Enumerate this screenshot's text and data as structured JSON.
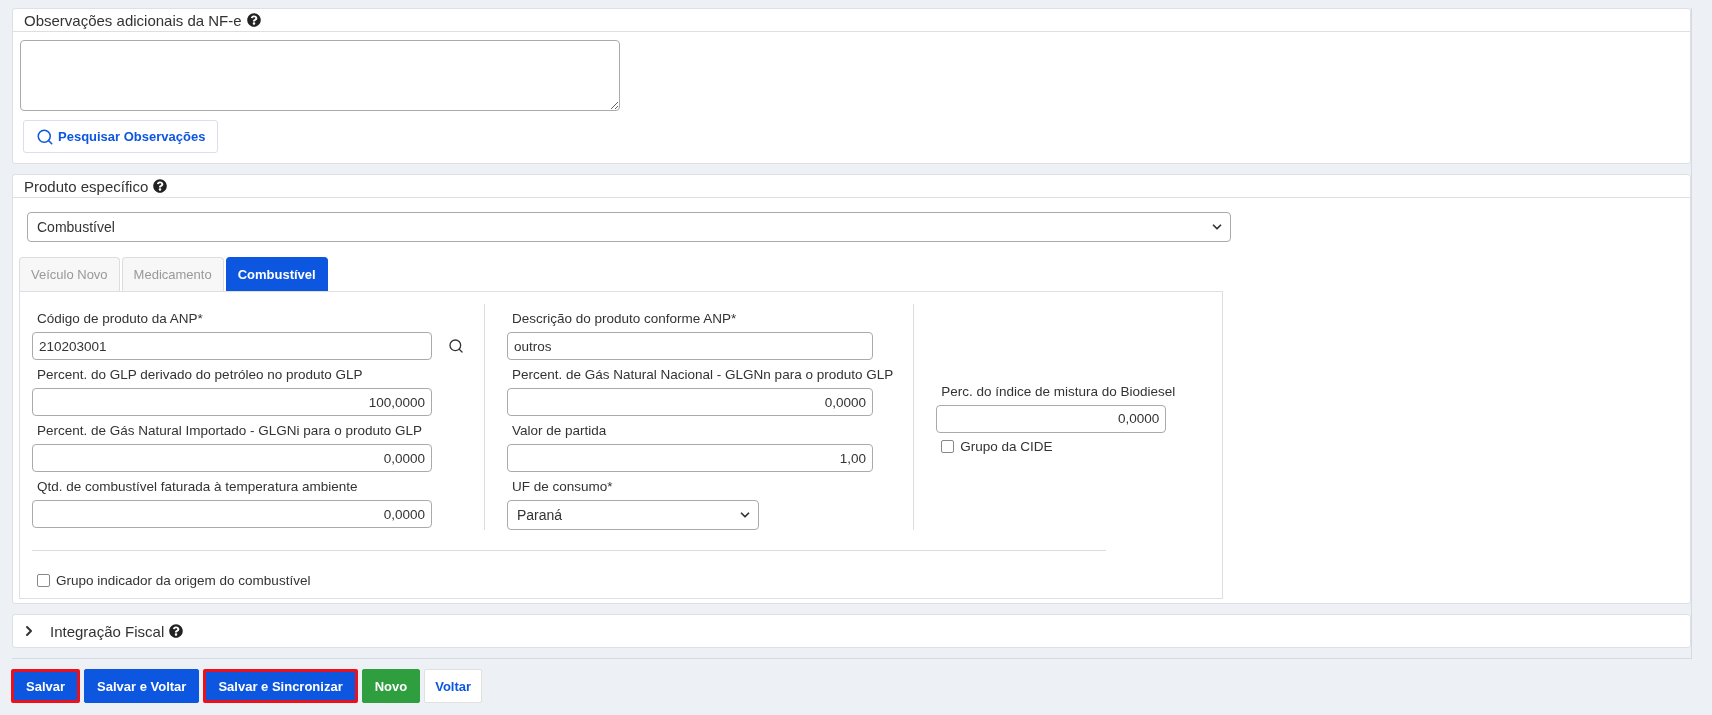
{
  "observations_panel": {
    "title": "Observações adicionais da NF-e",
    "search_button": "Pesquisar Observações"
  },
  "product_panel": {
    "title": "Produto específico",
    "type_select": "Combustível",
    "tabs": [
      {
        "label": "Veículo Novo",
        "selected": false
      },
      {
        "label": "Medicamento",
        "selected": false
      },
      {
        "label": "Combustível",
        "selected": true
      }
    ],
    "columns": [
      {
        "fields": [
          {
            "kind": "text",
            "label": "Código de produto da ANP*",
            "value": "210203001",
            "lookup": true
          },
          {
            "kind": "number",
            "label": "Percent. do GLP derivado do petróleo no produto GLP",
            "value": "100,0000"
          },
          {
            "kind": "number",
            "label": "Percent. de Gás Natural Importado - GLGNi para o produto GLP",
            "value": "0,0000"
          },
          {
            "kind": "number",
            "label": "Qtd. de combustível faturada à temperatura ambiente",
            "value": "0,0000"
          }
        ]
      },
      {
        "fields": [
          {
            "kind": "text",
            "label": "Descrição do produto conforme ANP*",
            "value": "outros"
          },
          {
            "kind": "number",
            "label": "Percent. de Gás Natural Nacional - GLGNn para o produto GLP",
            "value": "0,0000"
          },
          {
            "kind": "number",
            "label": "Valor de partida",
            "value": "1,00"
          },
          {
            "kind": "select",
            "label": "UF de consumo*",
            "value": "Paraná"
          }
        ]
      },
      {
        "fields": [
          {
            "kind": "number",
            "label": "Perc. do índice de mistura do Biodiesel",
            "value": "0,0000"
          },
          {
            "kind": "checkbox",
            "label": "Grupo da CIDE",
            "checked": false
          }
        ]
      }
    ],
    "origin_checkbox": {
      "label": "Grupo indicador da origem do combustível",
      "checked": false
    }
  },
  "fiscal_panel": {
    "title": "Integração Fiscal",
    "expanded": false
  },
  "buttons": [
    {
      "label": "Salvar",
      "kind": "primary",
      "highlighted": true
    },
    {
      "label": "Salvar e Voltar",
      "kind": "primary",
      "highlighted": false
    },
    {
      "label": "Salvar e Sincronizar",
      "kind": "primary",
      "highlighted": true
    },
    {
      "label": "Novo",
      "kind": "success",
      "highlighted": false
    },
    {
      "label": "Voltar",
      "kind": "default",
      "highlighted": false
    }
  ]
}
